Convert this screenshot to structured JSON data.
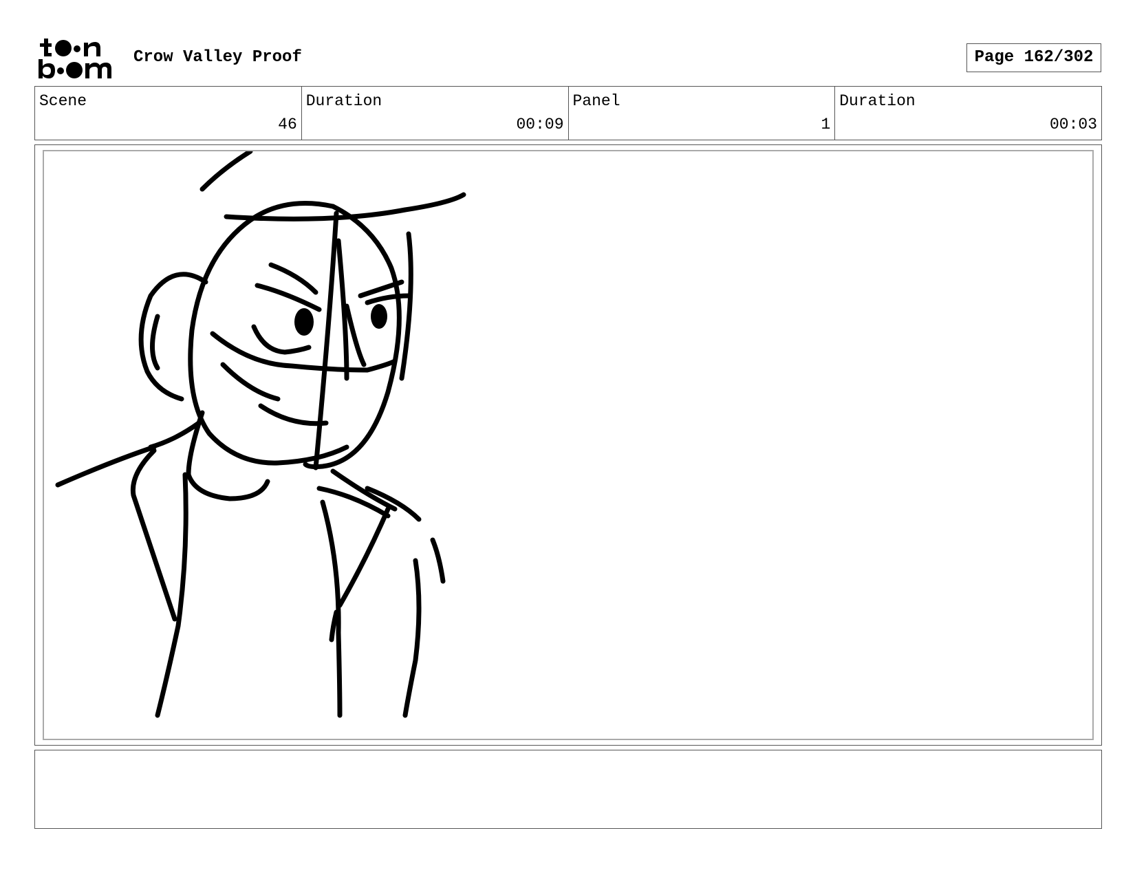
{
  "header": {
    "logo_text": "toon boom",
    "project_title": "Crow Valley Proof",
    "page_label": "Page 162/302"
  },
  "info": {
    "scene_label": "Scene",
    "scene_value": "46",
    "scene_duration_label": "Duration",
    "scene_duration_value": "00:09",
    "panel_label": "Panel",
    "panel_value": "1",
    "panel_duration_label": "Duration",
    "panel_duration_value": "00:03"
  },
  "panel": {
    "image_icon": "character-sketch"
  },
  "notes": {
    "text": ""
  }
}
